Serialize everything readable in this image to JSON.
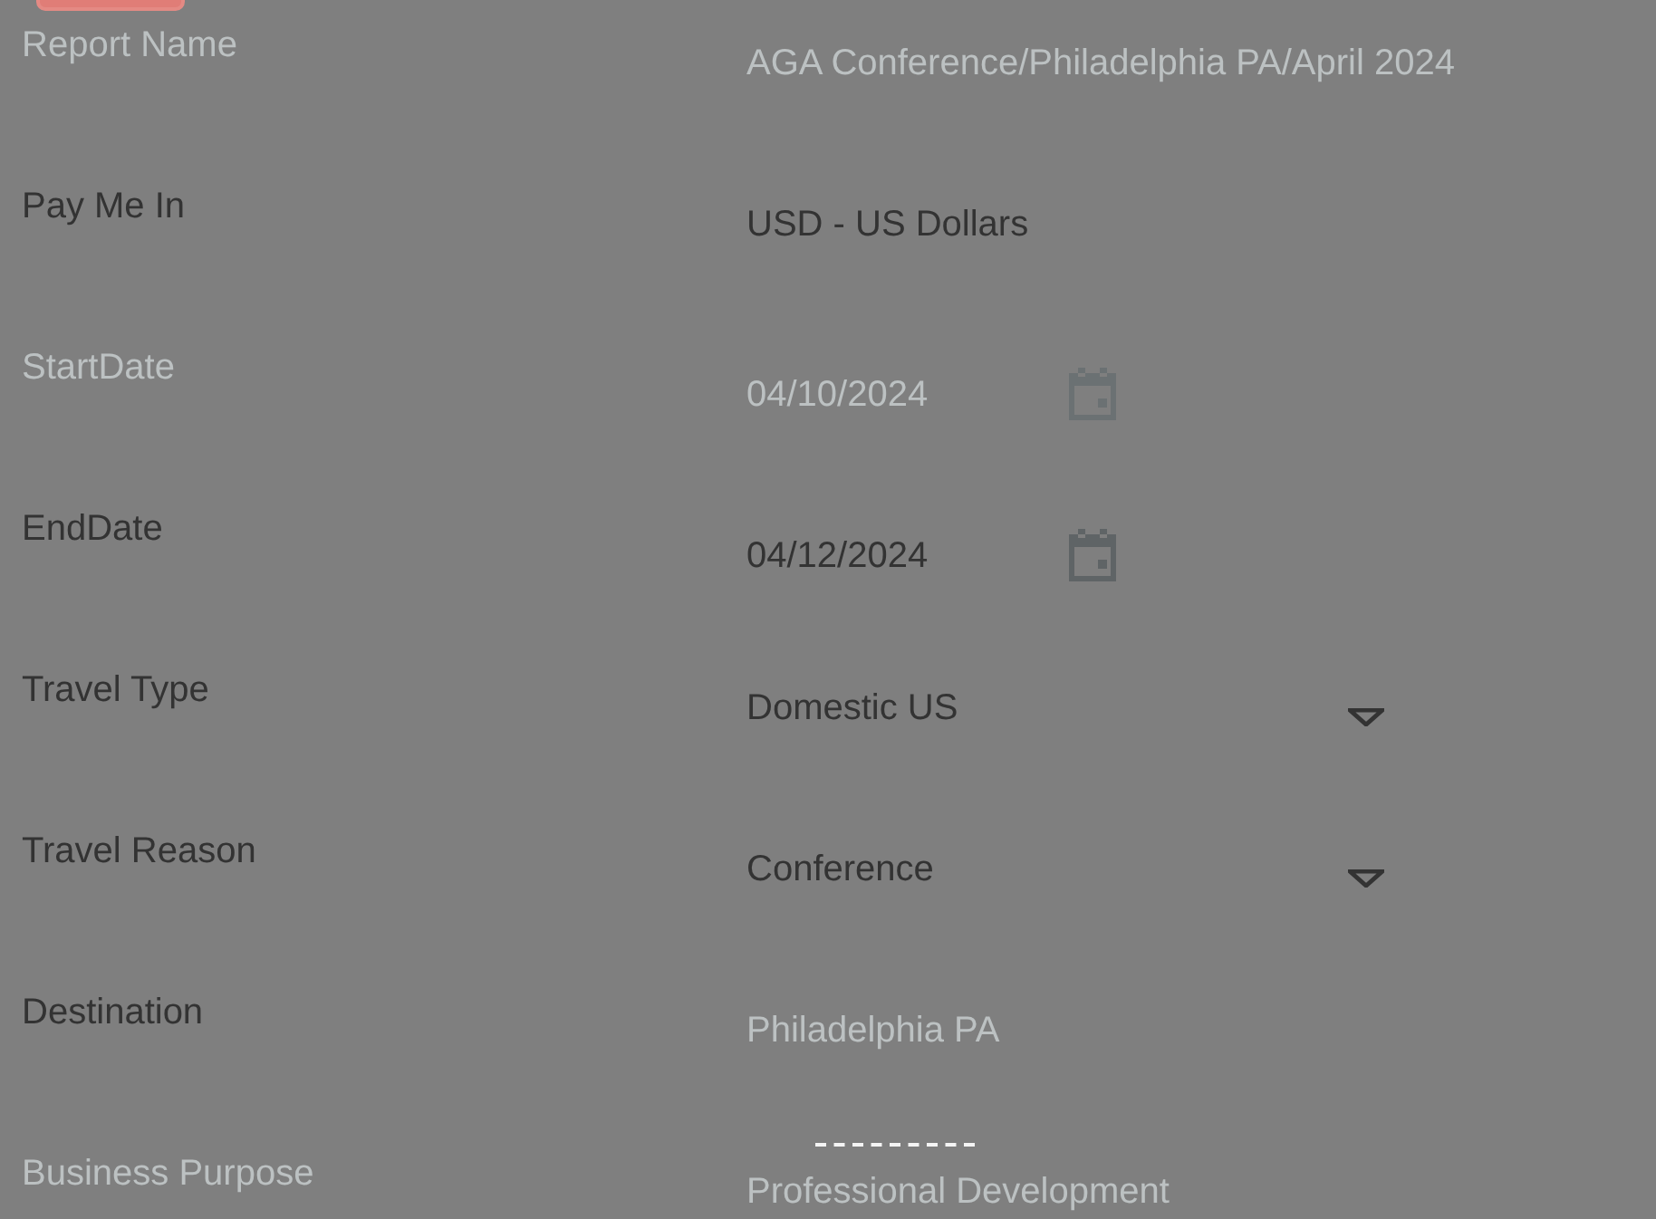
{
  "fields": [
    {
      "label": "Report Name",
      "label_disabled": true,
      "kind": "text",
      "value": "AGA Conference/Philadelphia PA/April 2024",
      "disabled": true
    },
    {
      "label": "Pay Me In",
      "label_disabled": false,
      "kind": "text",
      "value": "USD - US Dollars",
      "disabled": false
    },
    {
      "label": "StartDate",
      "label_disabled": true,
      "kind": "date",
      "value": "04/10/2024",
      "disabled": true
    },
    {
      "label": "EndDate",
      "label_disabled": false,
      "kind": "date",
      "value": "04/12/2024",
      "disabled": false
    },
    {
      "label": "Travel Type",
      "label_disabled": false,
      "kind": "select",
      "value": "Domestic US",
      "disabled": false
    },
    {
      "label": "Travel Reason",
      "label_disabled": false,
      "kind": "select",
      "value": "Conference",
      "disabled": false
    },
    {
      "label": "Destination",
      "label_disabled": false,
      "kind": "text",
      "value": "Philadelphia PA",
      "disabled": true
    },
    {
      "label": "Business Purpose",
      "label_disabled": true,
      "kind": "text",
      "value": "Professional Development",
      "disabled": true
    }
  ]
}
